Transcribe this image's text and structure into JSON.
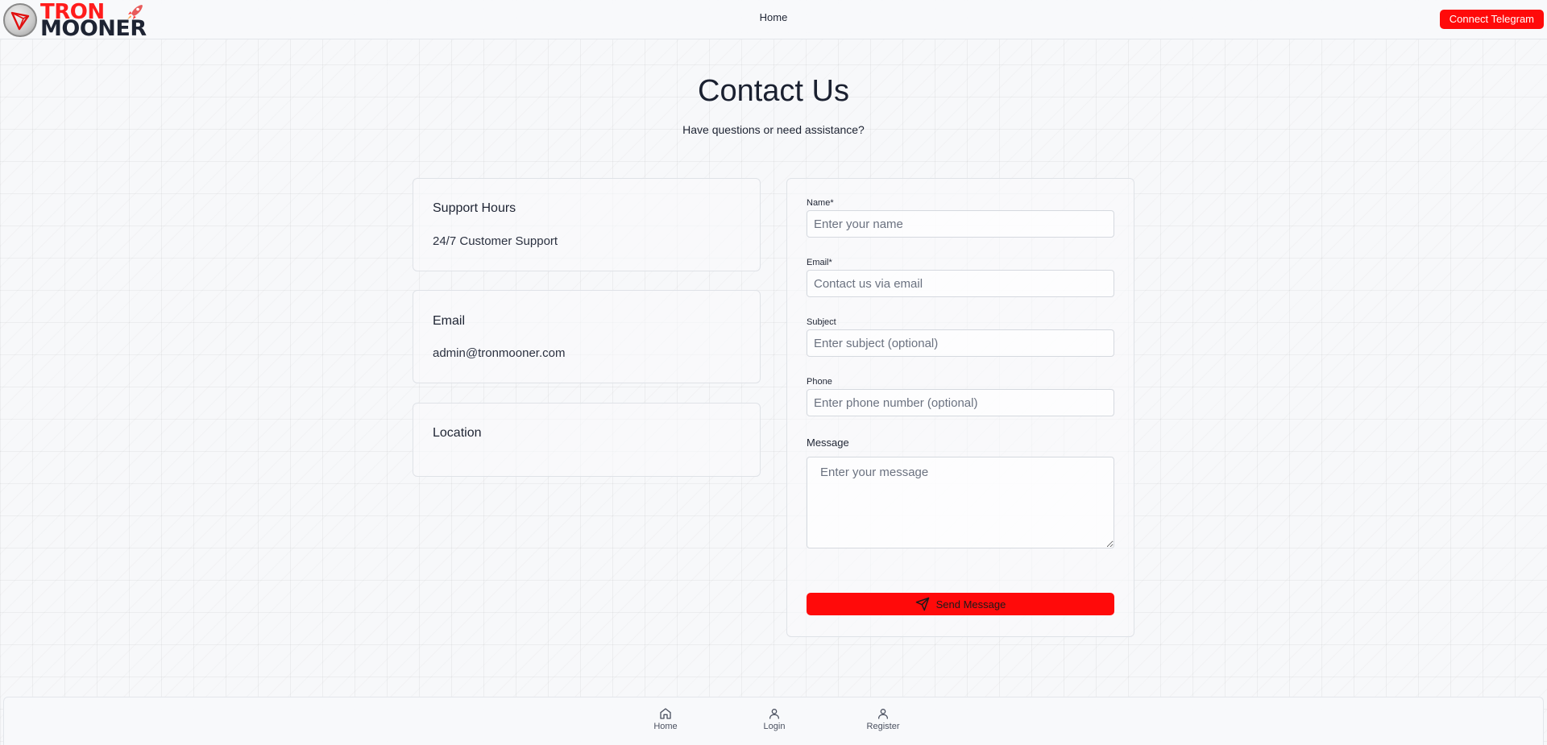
{
  "header": {
    "logo_line1": "TRON",
    "logo_line2": "MOONER",
    "nav_home": "Home",
    "telegram_button": "Connect Telegram"
  },
  "page": {
    "title": "Contact Us",
    "subtitle": "Have questions or need assistance?"
  },
  "info_cards": [
    {
      "title": "Support Hours",
      "value": "24/7 Customer Support"
    },
    {
      "title": "Email",
      "value": "admin@tronmooner.com"
    },
    {
      "title": "Location",
      "value": ""
    }
  ],
  "form": {
    "name_label": "Name*",
    "name_placeholder": "Enter your name",
    "email_label": "Email*",
    "email_placeholder": "Contact us via email",
    "subject_label": "Subject",
    "subject_placeholder": "Enter subject (optional)",
    "phone_label": "Phone",
    "phone_placeholder": "Enter phone number (optional)",
    "message_label": "Message",
    "message_placeholder": "Enter your message",
    "send_button": "Send Message"
  },
  "bottom_nav": {
    "home": "Home",
    "login": "Login",
    "register": "Register"
  },
  "colors": {
    "accent": "#ff0a0a",
    "text": "#1e2433"
  },
  "icons": {
    "send": "send-icon",
    "home": "home-icon",
    "login": "user-icon",
    "register": "user-icon",
    "logo_rocket": "rocket-icon"
  }
}
